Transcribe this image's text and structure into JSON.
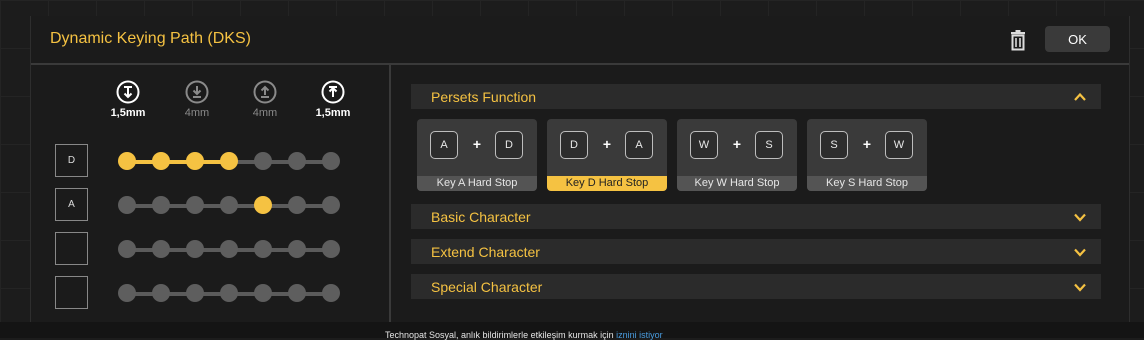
{
  "dialog": {
    "title": "Dynamic Keying Path (DKS)",
    "ok_label": "OK",
    "icons": {
      "delete": "trash-icon"
    }
  },
  "travel_columns": [
    {
      "label": "1,5mm",
      "icon": "press-down-icon",
      "state": "active"
    },
    {
      "label": "4mm",
      "icon": "bottom-out-icon",
      "state": "dim"
    },
    {
      "label": "4mm",
      "icon": "release-up-icon",
      "state": "dim"
    },
    {
      "label": "1,5mm",
      "icon": "release-top-icon",
      "state": "active"
    }
  ],
  "key_rows": [
    {
      "key": "D",
      "dots_total": 7,
      "active_dots": [
        1,
        2,
        3,
        4
      ],
      "fill_to": 4
    },
    {
      "key": "A",
      "dots_total": 7,
      "active_dots": [
        5
      ],
      "fill_to": 0
    },
    {
      "key": "",
      "dots_total": 7,
      "active_dots": [],
      "fill_to": 0
    },
    {
      "key": "",
      "dots_total": 7,
      "active_dots": [],
      "fill_to": 0
    }
  ],
  "sections": [
    {
      "label": "Persets Function",
      "expanded": true
    },
    {
      "label": "Basic Character",
      "expanded": false
    },
    {
      "label": "Extend Character",
      "expanded": false
    },
    {
      "label": "Special Character",
      "expanded": false
    }
  ],
  "presets": [
    {
      "keys": [
        "A",
        "D"
      ],
      "plus": "+",
      "label": "Key A Hard Stop",
      "selected": false
    },
    {
      "keys": [
        "D",
        "A"
      ],
      "plus": "+",
      "label": "Key D Hard Stop",
      "selected": true
    },
    {
      "keys": [
        "W",
        "S"
      ],
      "plus": "+",
      "label": "Key W Hard Stop",
      "selected": false
    },
    {
      "keys": [
        "S",
        "W"
      ],
      "plus": "+",
      "label": "Key S Hard Stop",
      "selected": false
    }
  ],
  "notification": {
    "text": "Technopat Sosyal, anlık bildirimlerle etkileşim kurmak için ",
    "link": "iznini istiyor"
  },
  "colors": {
    "accent": "#f5c242",
    "dot_inactive": "#5e5e5e",
    "panel": "#2b2b2b"
  }
}
